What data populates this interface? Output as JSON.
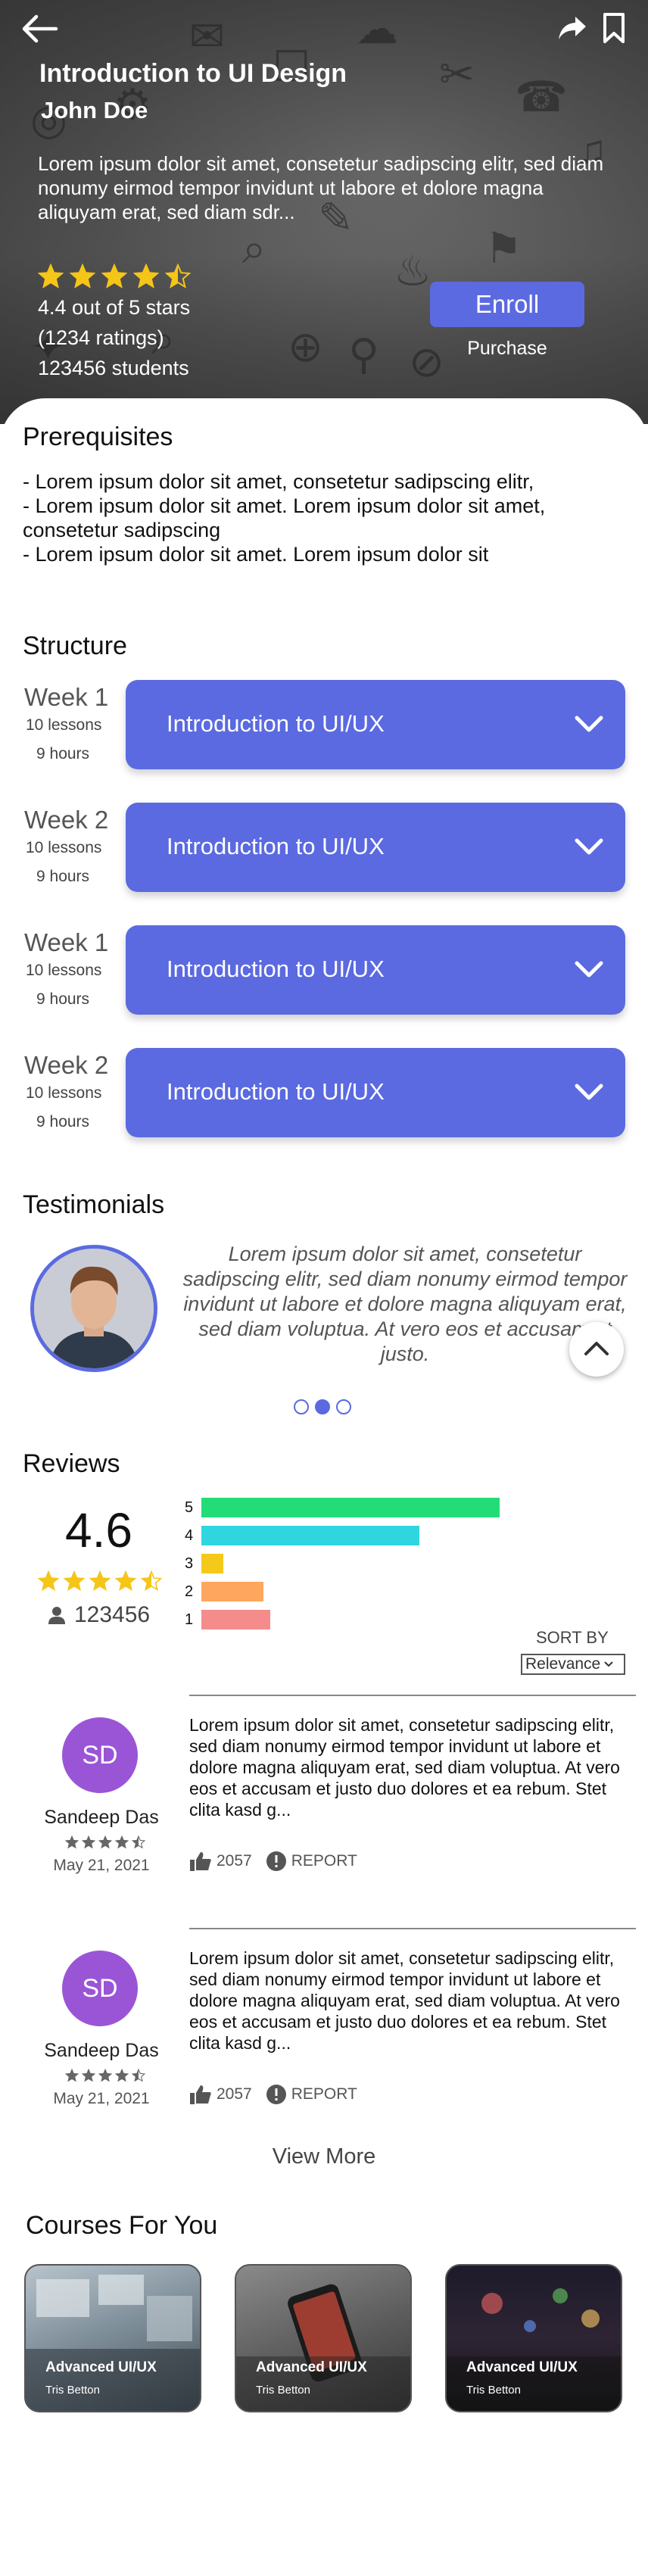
{
  "hero": {
    "title": "Introduction to UI Design",
    "author": "John Doe",
    "description": "Lorem ipsum dolor sit amet, consetetur sadipscing elitr, sed diam nonumy eirmod tempor invidunt ut labore et dolore magna aliquyam erat, sed diam sdr...",
    "rating_stars": 4.5,
    "rating_text": "4.4 out of 5 stars",
    "ratings_count": "(1234 ratings)",
    "students": "123456 students",
    "enroll_label": "Enroll",
    "purchase_label": "Purchase",
    "icons": [
      "back-arrow-icon",
      "share-icon",
      "bookmark-icon"
    ]
  },
  "prerequisites": {
    "heading": "Prerequisites",
    "items": [
      "- Lorem ipsum dolor sit amet, consetetur sadipscing elitr,",
      "- Lorem ipsum dolor sit amet. Lorem ipsum dolor sit amet, consetetur sadipscing",
      "- Lorem ipsum dolor sit amet. Lorem ipsum dolor sit"
    ]
  },
  "structure": {
    "heading": "Structure",
    "weeks": [
      {
        "week": "Week 1",
        "lessons": "10 lessons",
        "hours": "9 hours",
        "title": "Introduction to UI/UX"
      },
      {
        "week": "Week 2",
        "lessons": "10 lessons",
        "hours": "9 hours",
        "title": "Introduction to UI/UX"
      },
      {
        "week": "Week 1",
        "lessons": "10 lessons",
        "hours": "9 hours",
        "title": "Introduction to UI/UX"
      },
      {
        "week": "Week 2",
        "lessons": "10 lessons",
        "hours": "9 hours",
        "title": "Introduction to UI/UX"
      }
    ]
  },
  "testimonials": {
    "heading": "Testimonials",
    "quote": "Lorem ipsum dolor sit amet, consetetur sadipscing elitr, sed diam nonumy eirmod tempor invidunt ut labore et dolore magna aliquyam erat, sed diam voluptua. At vero eos et accusam et justo.",
    "active_dot": 1,
    "dot_count": 3
  },
  "reviews": {
    "heading": "Reviews",
    "average": "4.6",
    "average_stars": 4.5,
    "count": "123456",
    "distribution": [
      {
        "star": "5",
        "value": 0.82,
        "color": "#22dd77"
      },
      {
        "star": "4",
        "value": 0.6,
        "color": "#2fd6e0"
      },
      {
        "star": "3",
        "value": 0.06,
        "color": "#f5c91a"
      },
      {
        "star": "2",
        "value": 0.17,
        "color": "#ffa65e"
      },
      {
        "star": "1",
        "value": 0.19,
        "color": "#f58c8c"
      }
    ],
    "sort_label": "SORT BY",
    "sort_value": "Relevance",
    "items": [
      {
        "initials": "SD",
        "name": "Sandeep Das",
        "stars": 4.5,
        "date": "May 21, 2021",
        "body": "Lorem ipsum dolor sit amet, consetetur sadipscing elitr, sed diam nonumy eirmod tempor invidunt ut labore et dolore magna aliquyam erat, sed diam voluptua. At vero eos et accusam et justo duo dolores et ea rebum. Stet clita kasd g...",
        "likes": "2057",
        "report_label": "REPORT"
      },
      {
        "initials": "SD",
        "name": "Sandeep Das",
        "stars": 4.5,
        "date": "May 21, 2021",
        "body": "Lorem ipsum dolor sit amet, consetetur sadipscing elitr, sed diam nonumy eirmod tempor invidunt ut labore et dolore magna aliquyam erat, sed diam voluptua. At vero eos et accusam et justo duo dolores et ea rebum. Stet clita kasd g...",
        "likes": "2057",
        "report_label": "REPORT"
      }
    ],
    "view_more": "View More"
  },
  "courses_for_you": {
    "heading": "Courses For You",
    "cards": [
      {
        "title": "Advanced UI/UX",
        "author": "Tris Betton"
      },
      {
        "title": "Advanced UI/UX",
        "author": "Tris Betton"
      },
      {
        "title": "Advanced UI/UX",
        "author": "Tris Betton"
      }
    ]
  },
  "colors": {
    "accent": "#5b6ae0",
    "star": "#f5c518",
    "review_avatar": "#9a55d6"
  }
}
